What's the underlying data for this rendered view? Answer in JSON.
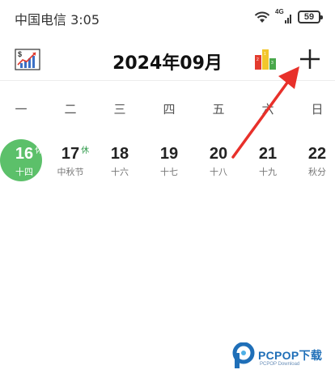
{
  "status_bar": {
    "carrier_time": "中国电信 3:05",
    "network": "4G",
    "battery": "59"
  },
  "header": {
    "title": "2024年09月",
    "stats_icon": "income-stats-icon",
    "chart_icon": "bar-chart-icon",
    "add_icon": "plus-icon"
  },
  "weekdays": [
    "一",
    "二",
    "三",
    "四",
    "五",
    "六",
    "日"
  ],
  "days": [
    {
      "num": "16",
      "tag": "休",
      "sub": "十四",
      "selected": true
    },
    {
      "num": "17",
      "tag": "休",
      "sub": "中秋节",
      "selected": false
    },
    {
      "num": "18",
      "tag": "",
      "sub": "十六",
      "selected": false
    },
    {
      "num": "19",
      "tag": "",
      "sub": "十七",
      "selected": false
    },
    {
      "num": "20",
      "tag": "",
      "sub": "十八",
      "selected": false
    },
    {
      "num": "21",
      "tag": "",
      "sub": "十九",
      "selected": false
    },
    {
      "num": "22",
      "tag": "",
      "sub": "秋分",
      "selected": false
    }
  ],
  "colors": {
    "selected": "#5cc06a",
    "holiday_tag": "#2e9a4a",
    "arrow": "#e8302a"
  },
  "watermark": {
    "brand": "PCPOP下载",
    "sub": "PCPOP Download"
  }
}
